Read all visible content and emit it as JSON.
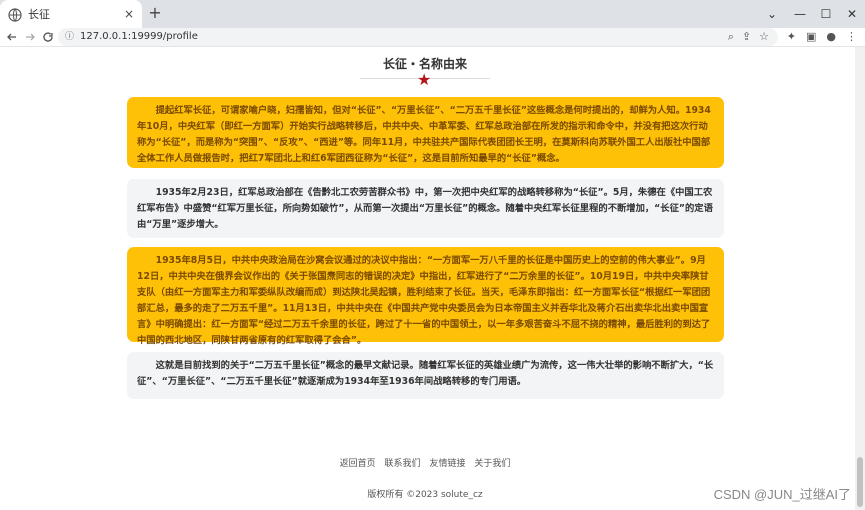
{
  "browser": {
    "tab_title": "长征",
    "tab_close": "×",
    "new_tab": "+",
    "url": "127.0.0.1:19999/profile",
    "window_controls": {
      "minimize": "—",
      "maximize": "☐",
      "close": "✕",
      "tabs_menu": "⌄"
    },
    "icons": {
      "globe": "globe-icon",
      "back": "back-arrow-icon",
      "forward": "forward-arrow-icon",
      "reload": "reload-icon",
      "lock": "info-icon",
      "zoom": "zoom-icon",
      "share": "share-icon",
      "bookmark": "star-icon",
      "extensions": "puzzle-icon",
      "sidebar": "sidebar-icon",
      "profile": "profile-icon",
      "menu": "kebab-menu-icon"
    }
  },
  "page": {
    "title": "长征・名称由来",
    "paragraphs": [
      "提起红军长征，可谓家喻户晓，妇孺皆知，但对“长征”、“万里长征”、“二万五千里长征”这些概念是何时提出的，却鲜为人知。1934年10月，中央红军（即红一方面军）开始实行战略转移后，中共中央、中革军委、红军总政治部在所发的指示和命令中，并没有把这次行动称为“长征”，而是称为“突围”、“反攻”、“西进”等。同年11月，中共驻共产国际代表团团长王明，在莫斯科向苏联外国工人出版社中国部全体工作人员做报告时，把红7军团北上和红6军团西征称为“长征”，这是目前所知最早的“长征”概念。",
      "1935年2月23日，红军总政治部在《告黔北工农劳苦群众书》中，第一次把中央红军的战略转移称为“长征”。5月，朱德在《中国工农红军布告》中盛赞“红军万里长征，所向势如破竹”，从而第一次提出“万里长征”的概念。随着中央红军长征里程的不断增加，“长征”的定语由“万里”逐步增大。",
      "1935年8月5日，中共中央政治局在沙窝会议通过的决议中指出：“一方面军一万八千里的长征是中国历史上的空前的伟大事业”。9月12日，中共中央在俄界会议作出的《关于张国焘同志的错误的决定》中指出，红军进行了“二万余里的长征”。10月19日，中共中央率陕甘支队（由红一方面军主力和军委纵队改编而成）到达陕北吴起镇，胜利结束了长征。当天，毛泽东即指出：红一方面军长征“根据红一军团团部汇总，最多的走了二万五千里”。11月13日，中共中央在《中国共产党中央委员会为日本帝国主义并吞华北及蒋介石出卖华北出卖中国宣言》中明确提出：红一方面军“经过二万五千余里的长征，跨过了十一省的中国领土，以一年多艰苦奋斗不屈不挠的精神，最后胜利的到达了中国的西北地区，同陕甘两省原有的红军取得了会合”。",
      "这就是目前找到的关于“二万五千里长征”概念的最早文献记录。随着红军长征的英雄业绩广为流传，这一伟大壮举的影响不断扩大，“长征”、“万里长征”、“二万五千里长征”就逐渐成为1934年至1936年间战略转移的专门用语。"
    ],
    "star_icon": "red-star-icon"
  },
  "footer": {
    "links": [
      "返回首页",
      "联系我们",
      "友情链接",
      "关于我们"
    ],
    "copyright": "版权所有 ©2023 solute_cz"
  },
  "watermark": "CSDN @JUN_过继AI了",
  "colors": {
    "gold_card": "#ffc107",
    "gray_card": "#f3f4f6",
    "star": "#b3161a"
  }
}
